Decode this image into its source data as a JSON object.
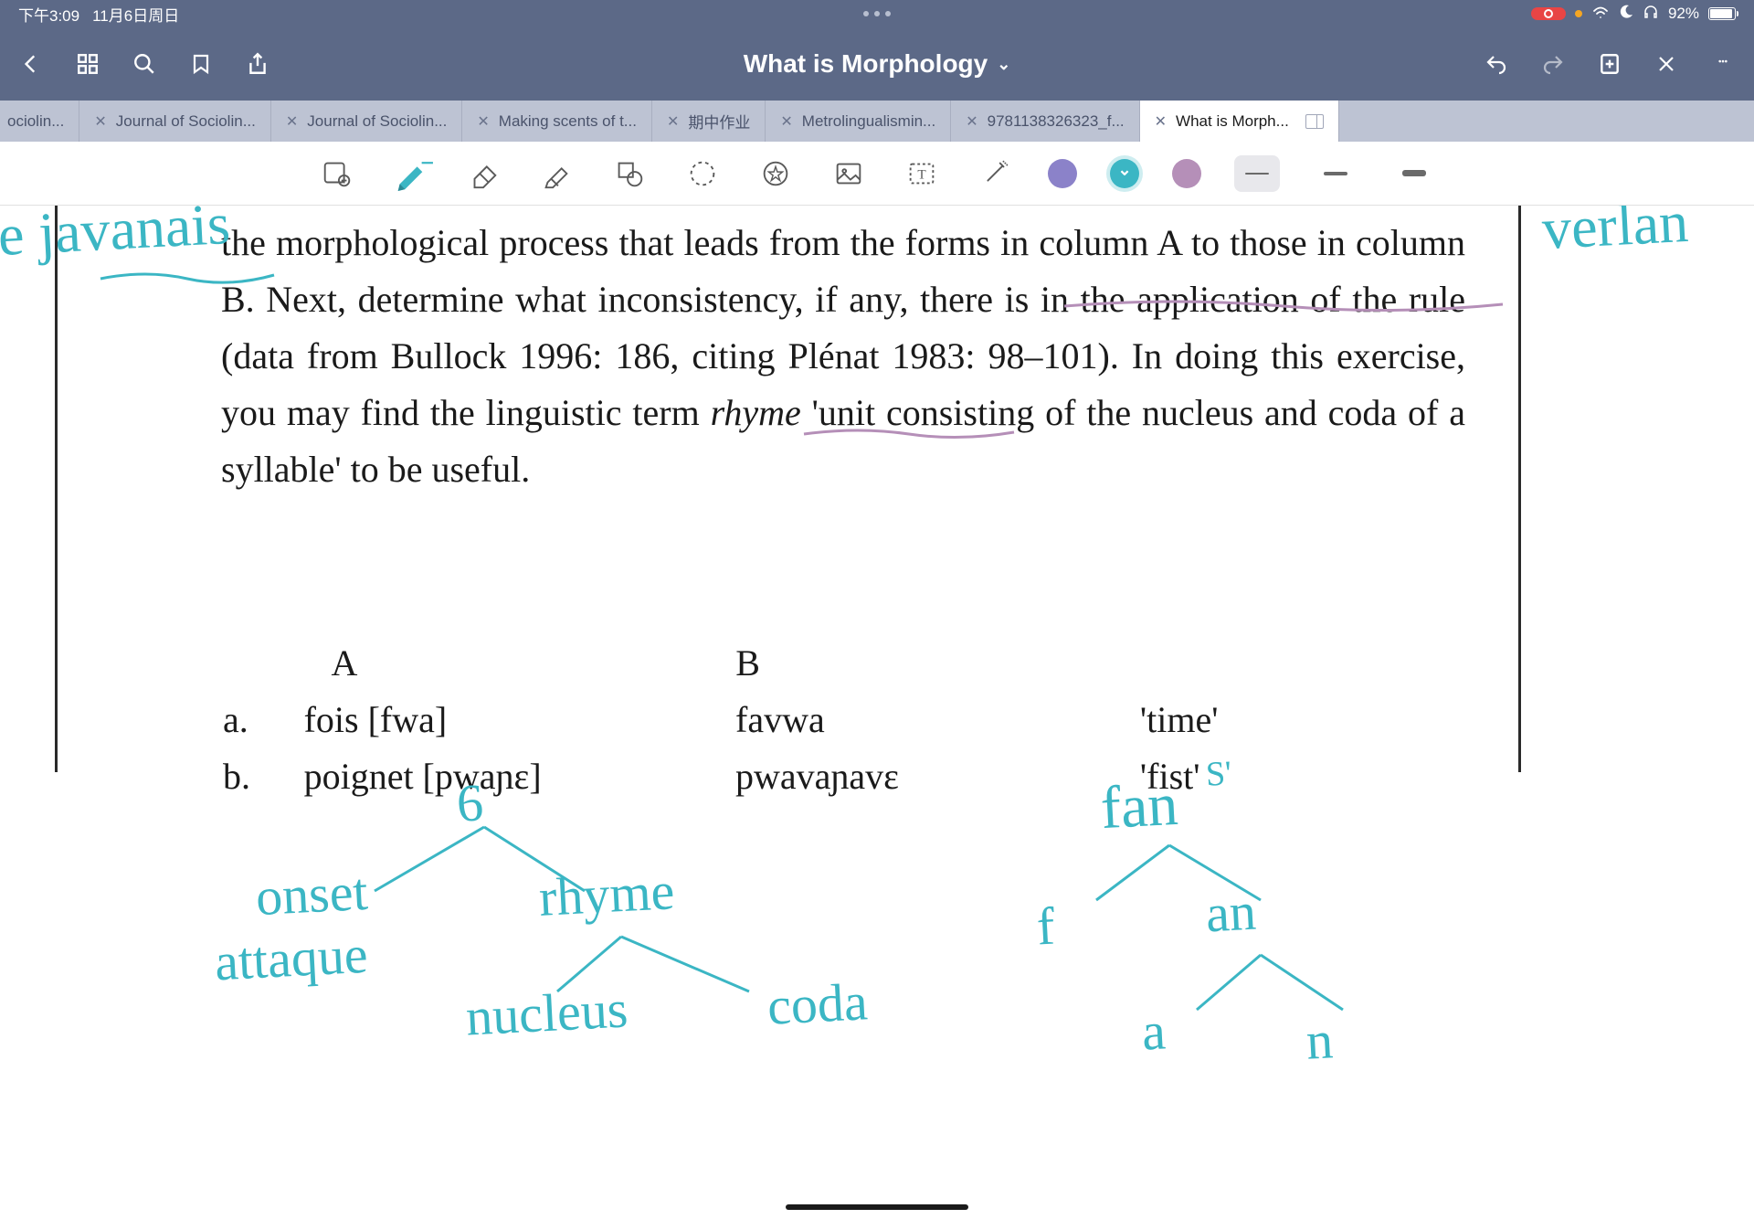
{
  "status": {
    "time": "下午3:09",
    "date": "11月6日周日",
    "battery_pct": "92%"
  },
  "title": "What is Morphology",
  "tabs": [
    {
      "label": "ociolin...",
      "closeable": false
    },
    {
      "label": "Journal of Sociolin...",
      "closeable": true
    },
    {
      "label": "Journal of Sociolin...",
      "closeable": true
    },
    {
      "label": "Making scents of t...",
      "closeable": true
    },
    {
      "label": "期中作业",
      "closeable": true
    },
    {
      "label": "Metrolingualismin...",
      "closeable": true
    },
    {
      "label": "9781138326323_f...",
      "closeable": true
    },
    {
      "label": "What is Morph...",
      "closeable": true,
      "active": true
    }
  ],
  "colors": {
    "purple": "#8b82c9",
    "teal": "#3bb6c4",
    "mauve": "#b58fb8"
  },
  "document": {
    "paragraph_html": "the morphological process that leads from the forms in column A to those in column B. Next, determine what inconsistency, if any, there is in the application of the rule (data from Bullock 1996: 186, citing Plénat 1983: 98–101). In doing this exercise, you may find the linguistic term <i>rhyme</i> 'unit consisting of the nucleus and coda of a syllable' to be useful.",
    "col_a_head": "A",
    "col_b_head": "B",
    "rows": [
      {
        "idx": "a.",
        "a": "fois [fwa]",
        "b": "favwa",
        "gloss": "'time'"
      },
      {
        "idx": "b.",
        "a": "poignet [pwaɲɛ]",
        "b": "pwavaɲavɛ",
        "gloss": "'fist'"
      }
    ]
  },
  "handwriting": {
    "left_margin": "le javanais",
    "right_margin": "verlan",
    "tree1_root": "6",
    "tree1_l": "onset",
    "tree1_r": "rhyme",
    "tree1_extra": "attaque",
    "tree1_rl": "nucleus",
    "tree1_rr": "coda",
    "tree2_root": "fan",
    "tree2_sup": "S'",
    "tree2_l": "f",
    "tree2_r": "an",
    "tree2_rl": "a",
    "tree2_rr": "n"
  }
}
